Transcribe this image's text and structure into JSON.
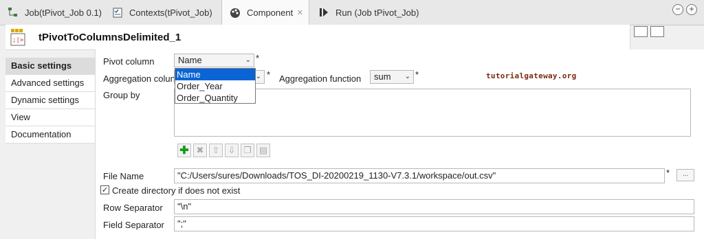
{
  "tabs": [
    {
      "label": "Job(tPivot_Job 0.1)",
      "icon": "job-icon"
    },
    {
      "label": "Contexts(tPivot_Job)",
      "icon": "contexts-icon"
    },
    {
      "label": "Component",
      "icon": "component-icon",
      "active": true
    },
    {
      "label": "Run (Job tPivot_Job)",
      "icon": "run-icon"
    }
  ],
  "window": {
    "minimize_label": "−",
    "maximize_label": "+"
  },
  "component": {
    "title": "tPivotToColumnsDelimited_1"
  },
  "nav": {
    "items": [
      {
        "label": "Basic settings",
        "active": true
      },
      {
        "label": "Advanced settings"
      },
      {
        "label": "Dynamic settings"
      },
      {
        "label": "View"
      },
      {
        "label": "Documentation"
      }
    ]
  },
  "form": {
    "pivot_column_label": "Pivot column",
    "pivot_column_value": "Name",
    "aggregation_column_label": "Aggregation colun",
    "aggregation_function_label": "Aggregation function",
    "aggregation_function_value": "sum",
    "group_by_label": "Group by",
    "required_marker": "*",
    "file_name_label": "File Name",
    "file_name_value": "\"C:/Users/sures/Downloads/TOS_DI-20200219_1130-V7.3.1/workspace/out.csv\"",
    "browse_label": "...",
    "create_dir_label": "Create directory if does not exist",
    "create_dir_checked": true,
    "row_separator_label": "Row Separator",
    "row_separator_value": "\"\\n\"",
    "field_separator_label": "Field Separator",
    "field_separator_value": "\";\""
  },
  "dropdown": {
    "options": [
      "Name",
      "Order_Year",
      "Order_Quantity"
    ],
    "selected": "Name"
  },
  "watermark": "tutorialgateway.org"
}
